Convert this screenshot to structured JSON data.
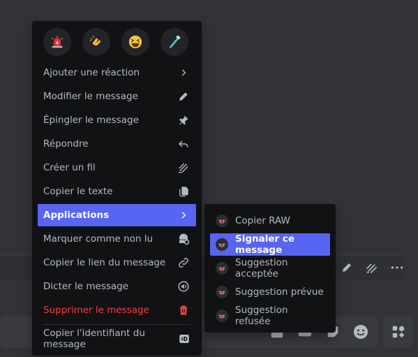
{
  "menu": {
    "reactions": [
      {
        "icon": "rotating-light-icon",
        "glyph": "🚨"
      },
      {
        "icon": "clapping-hands-icon",
        "glyph": "👏"
      },
      {
        "icon": "laughing-face-icon",
        "glyph": "😆"
      },
      {
        "icon": "toothbrush-icon",
        "glyph": "🪥"
      }
    ],
    "items": [
      {
        "label": "Ajouter une réaction",
        "icon": "chevron-right-icon"
      },
      {
        "label": "Modifier le message",
        "icon": "pencil-icon"
      },
      {
        "label": "Épingler le message",
        "icon": "pin-icon"
      },
      {
        "label": "Répondre",
        "icon": "reply-icon"
      },
      {
        "label": "Créer un fil",
        "icon": "thread-icon"
      },
      {
        "label": "Copier le texte",
        "icon": "copy-icon"
      },
      {
        "label": "Applications",
        "icon": "chevron-right-icon"
      },
      {
        "label": "Marquer comme non lu",
        "icon": "unread-icon"
      },
      {
        "label": "Copier le lien du message",
        "icon": "link-icon"
      },
      {
        "label": "Dicter le message",
        "icon": "speaker-icon"
      },
      {
        "label": "Supprimer le message",
        "icon": "trash-icon"
      },
      {
        "label": "Copier l'identifiant du message",
        "icon": "id-icon"
      }
    ]
  },
  "submenu": {
    "items": [
      {
        "label": "Copier RAW",
        "icon": "app-avatar-icon"
      },
      {
        "label": "Signaler ce message",
        "icon": "app-avatar-icon"
      },
      {
        "label": "Suggestion acceptée",
        "icon": "app-avatar-icon"
      },
      {
        "label": "Suggestion prévue",
        "icon": "app-avatar-icon"
      },
      {
        "label": "Suggestion refusée",
        "icon": "app-avatar-icon"
      }
    ]
  },
  "colors": {
    "accent": "#5865f2",
    "danger": "#f23f43",
    "menu_bg": "#111214",
    "text": "#b5bac1"
  }
}
